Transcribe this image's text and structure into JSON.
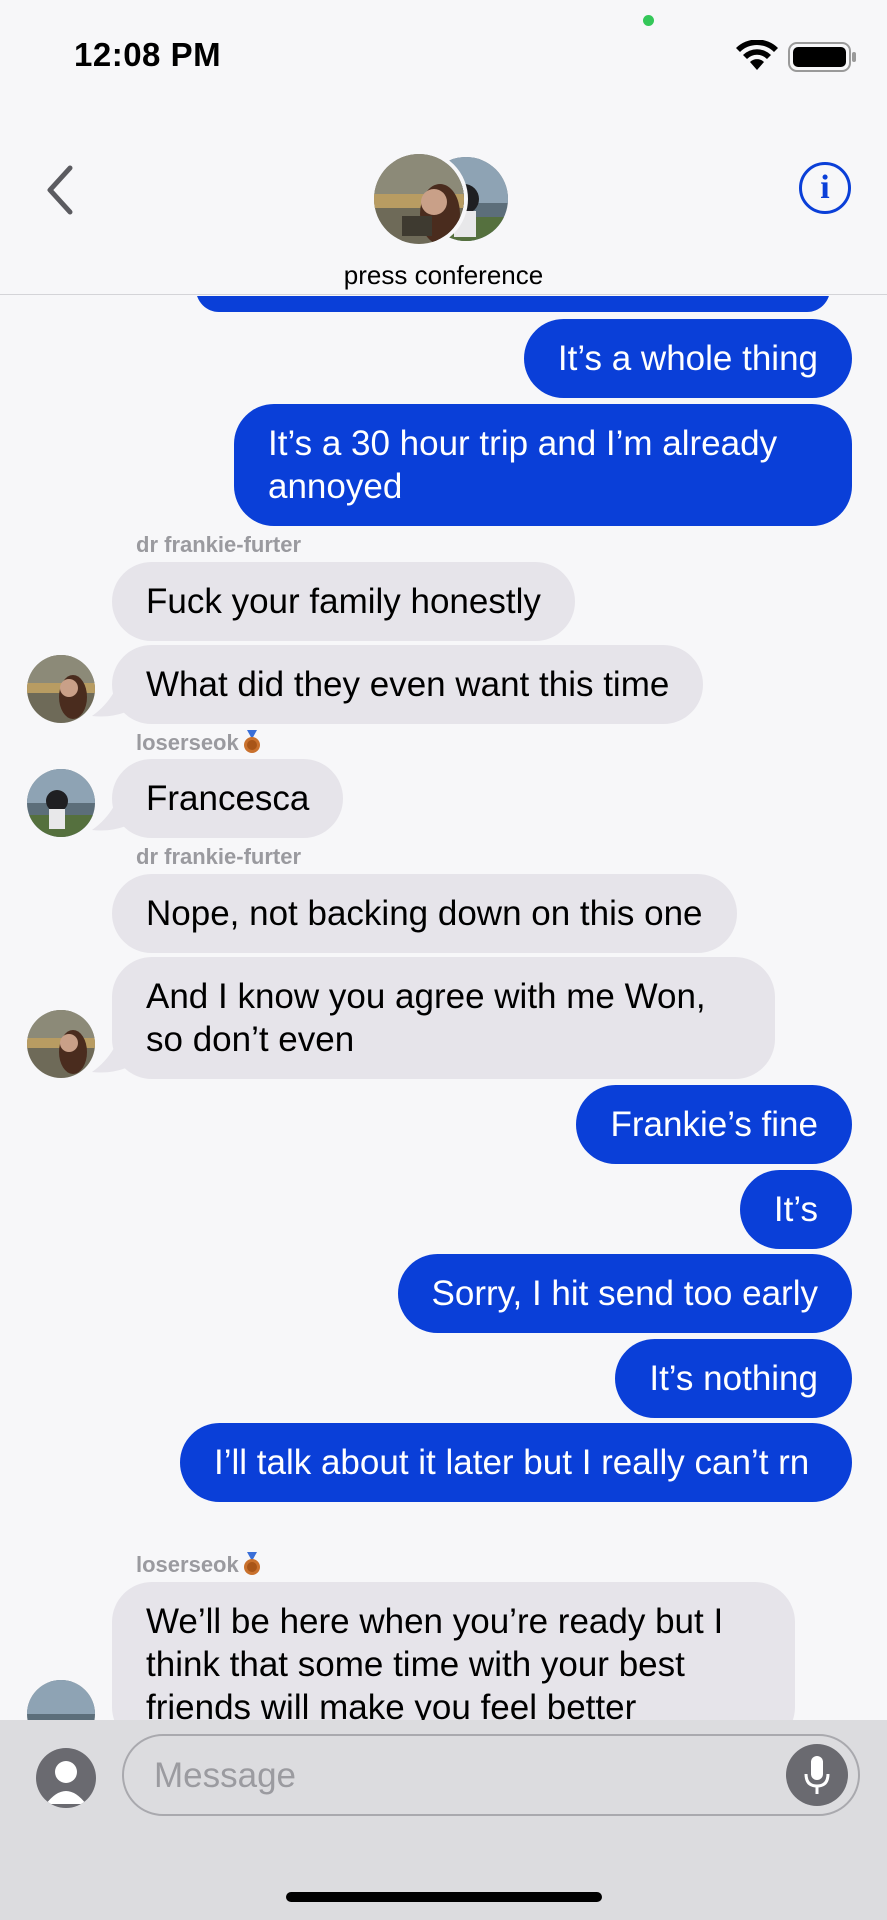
{
  "status_bar": {
    "time": "12:08 PM"
  },
  "header": {
    "group_name": "press conference",
    "back_icon": "chevron-left-icon",
    "info_label": "i"
  },
  "colors": {
    "outgoing": "#0a3fd8",
    "incoming": "#e6e4ea",
    "accent": "#0a3fd8"
  },
  "messages": [
    {
      "dir": "out",
      "text": "It’s a whole thing"
    },
    {
      "dir": "out",
      "text": "It’s a 30 hour trip and I’m already annoyed"
    },
    {
      "dir": "in",
      "sender": "dr frankie-furter",
      "text": "Fuck your family honestly"
    },
    {
      "dir": "in",
      "text": "What did they even want this time"
    },
    {
      "dir": "in",
      "sender": "loserseok",
      "text": "Francesca"
    },
    {
      "dir": "in",
      "sender": "dr frankie-furter",
      "text": "Nope, not backing down on this one"
    },
    {
      "dir": "in",
      "text": "And I know you agree with me Won, so don’t even"
    },
    {
      "dir": "out",
      "text": "Frankie’s fine"
    },
    {
      "dir": "out",
      "text": "It’s"
    },
    {
      "dir": "out",
      "text": "Sorry, I hit send too early"
    },
    {
      "dir": "out",
      "text": "It’s nothing"
    },
    {
      "dir": "out",
      "text": "I’ll talk about it later but I really can’t rn"
    },
    {
      "dir": "in",
      "sender": "loserseok",
      "text": "We’ll be here when you’re ready but I think that some time with your best friends will make you feel better"
    }
  ],
  "composer": {
    "placeholder": "Message"
  }
}
